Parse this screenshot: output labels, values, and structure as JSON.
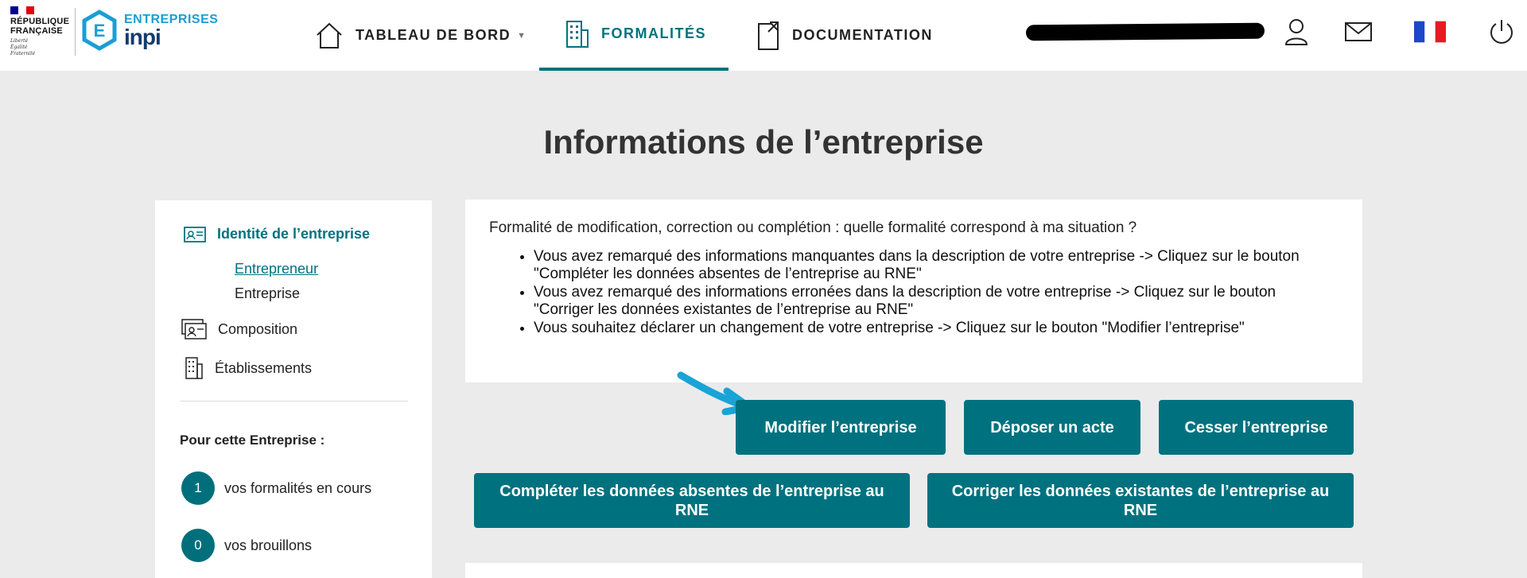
{
  "header": {
    "republique": [
      "RÉPUBLIQUE",
      "FRANÇAISE"
    ],
    "motto": [
      "Liberté",
      "Égalité",
      "Fraternité"
    ],
    "brand_top": "ENTREPRISES",
    "brand_bottom": "inpi",
    "nav": [
      {
        "label": "TABLEAU DE BORD",
        "icon": "home-icon",
        "has_caret": true
      },
      {
        "label": "FORMALITÉS",
        "icon": "building-icon",
        "active": true
      },
      {
        "label": "DOCUMENTATION",
        "icon": "document-icon"
      }
    ],
    "icons": [
      "user-icon",
      "mail-icon",
      "french-flag-icon",
      "power-icon"
    ]
  },
  "page_title": "Informations de l’entreprise",
  "sidebar": {
    "items": [
      {
        "label": "Identité de l’entreprise",
        "icon": "id-card-icon",
        "active": true
      },
      {
        "label": "Composition",
        "icon": "people-cards-icon"
      },
      {
        "label": "Établissements",
        "icon": "buildings-icon"
      }
    ],
    "subitems": [
      {
        "label": "Entrepreneur",
        "link": true
      },
      {
        "label": "Entreprise"
      }
    ],
    "section_heading": "Pour cette Entreprise :",
    "counters": [
      {
        "value": "1",
        "label": "vos formalités en cours"
      },
      {
        "value": "0",
        "label": "vos brouillons"
      }
    ]
  },
  "info": {
    "question": "Formalité de modification, correction ou complétion : quelle formalité correspond à ma situation ?",
    "bullets": [
      "Vous avez remarqué des informations manquantes dans la description de votre entreprise -> Cliquez sur le bouton \"Compléter les données absentes de l’entreprise au RNE\"",
      "Vous avez remarqué des informations erronées dans la description de votre entreprise -> Cliquez sur le bouton \"Corriger les données existantes de l’entreprise au RNE\"",
      "Vous souhaitez déclarer un changement de votre entreprise -> Cliquez sur le bouton \"Modifier l’entreprise\""
    ]
  },
  "buttons": {
    "modify": "Modifier l’entreprise",
    "deposit": "Déposer un acte",
    "cease": "Cesser l’entreprise",
    "complete": "Compléter les données absentes de l’entreprise au RNE",
    "correct": "Corriger les données existantes de l’entreprise au RNE"
  },
  "colors": {
    "accent": "#00727f",
    "background": "#ebebeb",
    "arrow": "#1aa3d6"
  }
}
